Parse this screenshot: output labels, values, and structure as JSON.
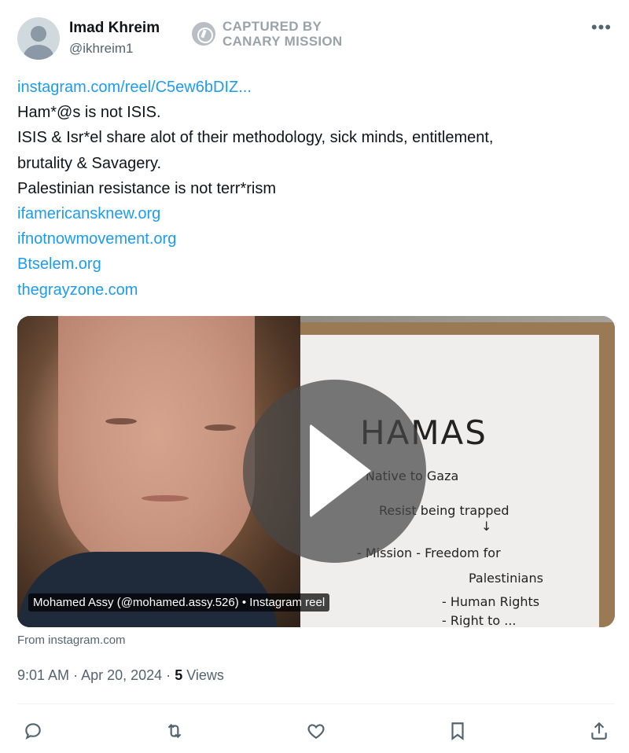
{
  "author": {
    "name": "Imad Khreim",
    "handle": "@ikhreim1"
  },
  "watermark": {
    "line1": "CAPTURED BY",
    "line2": "CANARY MISSION"
  },
  "more_icon": "•••",
  "tweet": {
    "link": "instagram.com/reel/C5ew6bDIZ...",
    "line1": "Ham*@s is not ISIS.",
    "line2": "ISIS & Isr*el share alot of their methodology, sick minds, entitlement,",
    "line3": "brutality & Savagery.",
    "line4": "Palestinian resistance is not terr*rism",
    "links": [
      "ifamericansknew.org",
      "ifnotnowmovement.org",
      "Btselem.org",
      "thegrayzone.com"
    ]
  },
  "media": {
    "caption": "Mohamed Assy (@mohamed.assy.526) • Instagram reel",
    "source": "From instagram.com",
    "board": {
      "title": "HAMAS",
      "lines": [
        "- Native to Gaza",
        "Resist being trapped",
        "↓",
        "- Mission - Freedom for",
        "Palestinians",
        "- Human Rights",
        "- Right to ..."
      ]
    }
  },
  "meta": {
    "time": "9:01 AM",
    "date": "Apr 20, 2024",
    "views_count": "5",
    "views_label": "Views",
    "separator": "·"
  },
  "actions": [
    "reply-icon",
    "retweet-icon",
    "like-icon",
    "bookmark-icon",
    "share-icon"
  ]
}
